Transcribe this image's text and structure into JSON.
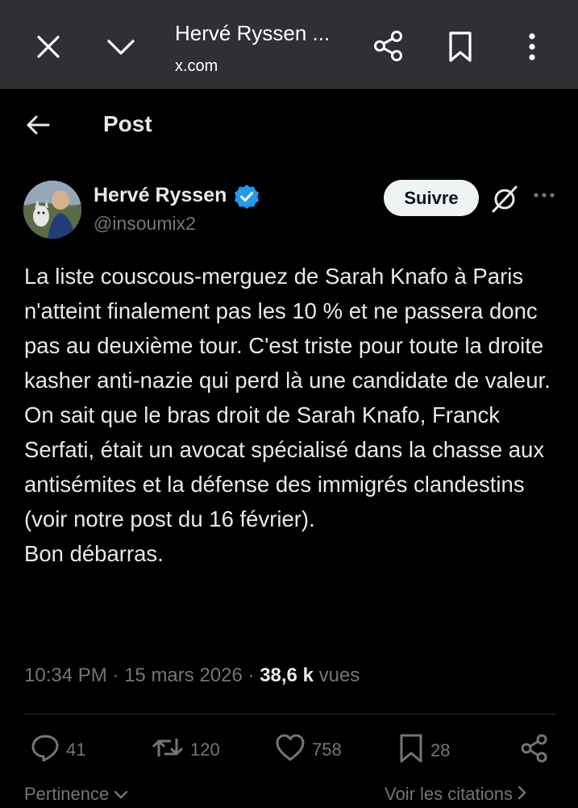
{
  "browser": {
    "title": "Hervé Ryssen ...",
    "url": "x.com",
    "icons": [
      "close-icon",
      "chevron-down-icon",
      "share-icon",
      "bookmark-icon",
      "more-vertical-icon"
    ]
  },
  "header": {
    "title": "Post"
  },
  "author": {
    "name": "Hervé Ryssen",
    "handle": "@insoumix2",
    "verified": true
  },
  "follow_label": "Suivre",
  "post": {
    "paragraphs": [
      "La liste couscous-merguez de Sarah Knafo à Paris n'atteint finalement pas les 10 % et ne passera donc pas au deuxième tour. C'est triste pour toute la droite kasher anti-nazie qui perd là une candidate de valeur.",
      "On sait que le bras droit de Sarah Knafo, Franck Serfati, était un avocat spécialisé dans la chasse aux antisémites et la défense des immigrés clandestins (voir notre post du 16 février).",
      "Bon débarras."
    ]
  },
  "meta": {
    "time": "10:34 PM",
    "date": "15 mars 2026",
    "views": "38,6 k",
    "views_label": "vues",
    "separator": "·"
  },
  "actions": {
    "replies": "41",
    "reposts": "120",
    "likes": "758",
    "bookmarks": "28"
  },
  "bottom": {
    "sort_label": "Pertinence",
    "quotes_label": "Voir les citations"
  },
  "colors": {
    "background": "#000000",
    "topbar": "#2f3033",
    "text": "#e7e9ea",
    "muted": "#71767b",
    "verified": "#1d9bf0"
  }
}
